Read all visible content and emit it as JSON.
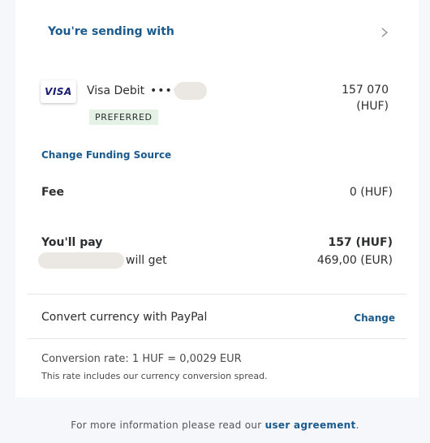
{
  "sending": {
    "title": "You're sending with"
  },
  "funding": {
    "logo_text": "VISA",
    "card_name": "Visa Debit",
    "card_mask": "••••",
    "amount": "157 070",
    "currency": "(HUF)",
    "badge": "PREFERRED",
    "change_link": "Change Funding Source"
  },
  "fee": {
    "label": "Fee",
    "value": "0 (HUF)"
  },
  "payment": {
    "you_pay_label": "You'll pay",
    "you_pay_value": "157 (HUF)",
    "will_get_label": "will get",
    "will_get_value": "469,00 (EUR)"
  },
  "conversion": {
    "label": "Convert currency with PayPal",
    "change_link": "Change",
    "rate": "Conversion rate: 1 HUF = 0,0029 EUR",
    "note": "This rate includes our currency conversion spread."
  },
  "footer": {
    "text": "For more information please read our",
    "link": "user agreement",
    "end": "."
  },
  "colors": {
    "link": "#1a5a8c",
    "text": "#2c2e2f",
    "badge_bg": "#e3f2e5",
    "page_bg": "#f5f7fa"
  }
}
